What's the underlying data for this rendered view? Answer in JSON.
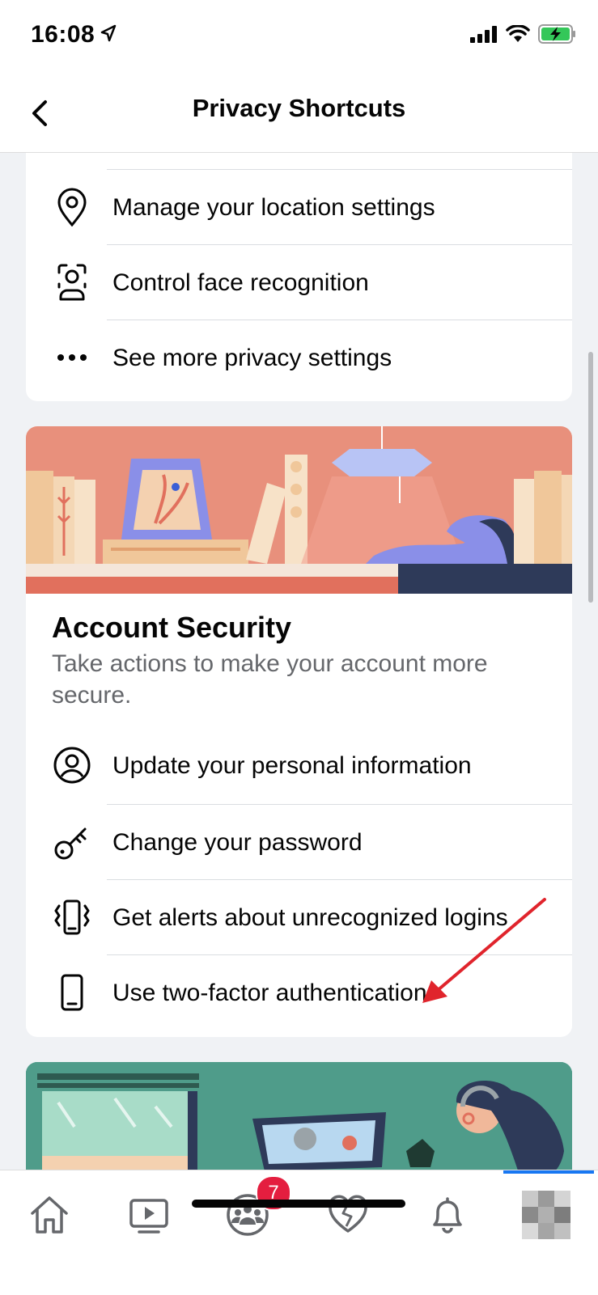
{
  "status_bar": {
    "time": "16:08"
  },
  "nav": {
    "title": "Privacy Shortcuts"
  },
  "privacy_rows": [
    {
      "label": "Manage your location settings",
      "icon": "location-pin-icon"
    },
    {
      "label": "Control face recognition",
      "icon": "face-scan-icon"
    },
    {
      "label": "See more privacy settings",
      "icon": "more-dots-icon"
    }
  ],
  "account_security": {
    "title": "Account Security",
    "description": "Take actions to make your account more secure.",
    "rows": [
      {
        "label": "Update your personal information",
        "icon": "person-circle-icon"
      },
      {
        "label": "Change your password",
        "icon": "key-icon"
      },
      {
        "label": "Get alerts about unrecognized logins",
        "icon": "vibrating-phone-icon"
      },
      {
        "label": "Use two-factor authentication",
        "icon": "phone-icon"
      }
    ]
  },
  "tab_bar": {
    "tabs": [
      "home-icon",
      "watch-icon",
      "groups-icon",
      "dating-heart-icon",
      "notifications-bell-icon",
      "profile-avatar-icon"
    ],
    "groups_badge": "7"
  },
  "colors": {
    "accent": "#1877f2",
    "badge": "#e41e3f",
    "annotation_arrow": "#e0242c"
  }
}
